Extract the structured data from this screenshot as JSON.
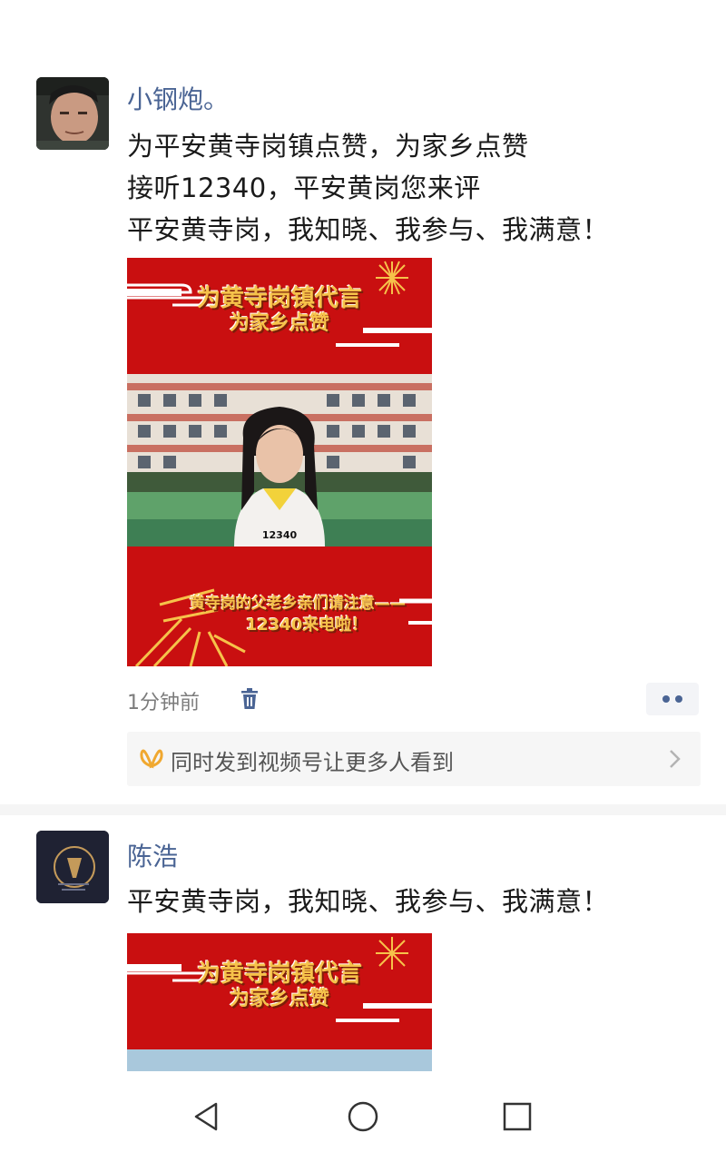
{
  "posts": [
    {
      "username": "小钢炮。",
      "lines": [
        "为平安黄寺岗镇点赞，为家乡点赞",
        "接听12340，平安黄岗您来评",
        "平安黄寺岗，我知晓、我参与、我满意！"
      ],
      "video": {
        "banner_top_line1": "为黄寺岗镇代言",
        "banner_top_line2": "为家乡点赞",
        "caption_number": "12340",
        "banner_bottom_line1": "黄寺岗的父老乡亲们请注意——",
        "banner_bottom_line2": "12340来电啦！"
      },
      "timestamp": "1分钟前",
      "delete_icon": "trash-icon",
      "more_icon": "more-dots-icon",
      "share_bar": {
        "icon": "channels-butterfly-icon",
        "label": "同时发到视频号让更多人看到",
        "arrow_icon": "chevron-right-icon"
      }
    },
    {
      "username": "陈浩",
      "lines": [
        "平安黄寺岗，我知晓、我参与、我满意！"
      ],
      "video": {
        "banner_top_line1": "为黄寺岗镇代言",
        "banner_top_line2": "为家乡点赞"
      }
    }
  ],
  "navbar": {
    "back_icon": "back-triangle-icon",
    "home_icon": "home-circle-icon",
    "recents_icon": "recents-square-icon"
  },
  "colors": {
    "username": "#4a6494",
    "banner_red": "#c90f10",
    "banner_gold": "#f6c24a",
    "share_icon": "#f0a830"
  }
}
